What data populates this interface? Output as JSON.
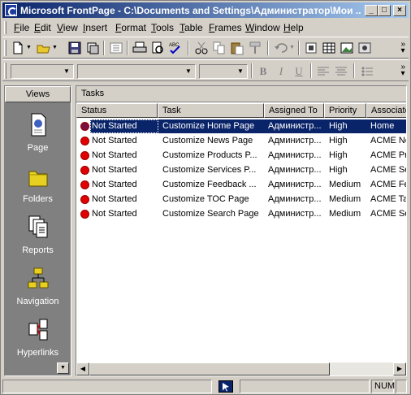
{
  "window": {
    "title": "Microsoft FrontPage - C:\\Documents and Settings\\Администратор\\Мои ...",
    "min_glyph": "_",
    "max_glyph": "□",
    "close_glyph": "×"
  },
  "menu": [
    "File",
    "Edit",
    "View",
    "Insert",
    "Format",
    "Tools",
    "Table",
    "Frames",
    "Window",
    "Help"
  ],
  "format_toolbar": {
    "bold": "B",
    "italic": "I",
    "underline": "U"
  },
  "views": {
    "header": "Views",
    "items": [
      {
        "label": "Page",
        "icon": "page-icon"
      },
      {
        "label": "Folders",
        "icon": "folders-icon"
      },
      {
        "label": "Reports",
        "icon": "reports-icon"
      },
      {
        "label": "Navigation",
        "icon": "navigation-icon"
      },
      {
        "label": "Hyperlinks",
        "icon": "hyperlinks-icon"
      }
    ]
  },
  "tasks": {
    "title": "Tasks",
    "columns": [
      "Status",
      "Task",
      "Assigned To",
      "Priority",
      "Associate"
    ],
    "rows": [
      {
        "status": "Not Started",
        "task": "Customize Home Page",
        "assigned": "Администр...",
        "priority": "High",
        "assoc": "Home"
      },
      {
        "status": "Not Started",
        "task": "Customize News Page",
        "assigned": "Администр...",
        "priority": "High",
        "assoc": "ACME Ne"
      },
      {
        "status": "Not Started",
        "task": "Customize Products P...",
        "assigned": "Администр...",
        "priority": "High",
        "assoc": "ACME Pro"
      },
      {
        "status": "Not Started",
        "task": "Customize Services P...",
        "assigned": "Администр...",
        "priority": "High",
        "assoc": "ACME Ser"
      },
      {
        "status": "Not Started",
        "task": "Customize Feedback ...",
        "assigned": "Администр...",
        "priority": "Medium",
        "assoc": "ACME Fe"
      },
      {
        "status": "Not Started",
        "task": "Customize TOC Page",
        "assigned": "Администр...",
        "priority": "Medium",
        "assoc": "ACME Tal"
      },
      {
        "status": "Not Started",
        "task": "Customize Search Page",
        "assigned": "Администр...",
        "priority": "Medium",
        "assoc": "ACME Se"
      }
    ]
  },
  "statusbar": {
    "num": "NUM"
  },
  "colors": {
    "title_start": "#0a246a",
    "title_end": "#a6caf0",
    "selection": "#0a246a",
    "status_dot": "#e00000"
  }
}
